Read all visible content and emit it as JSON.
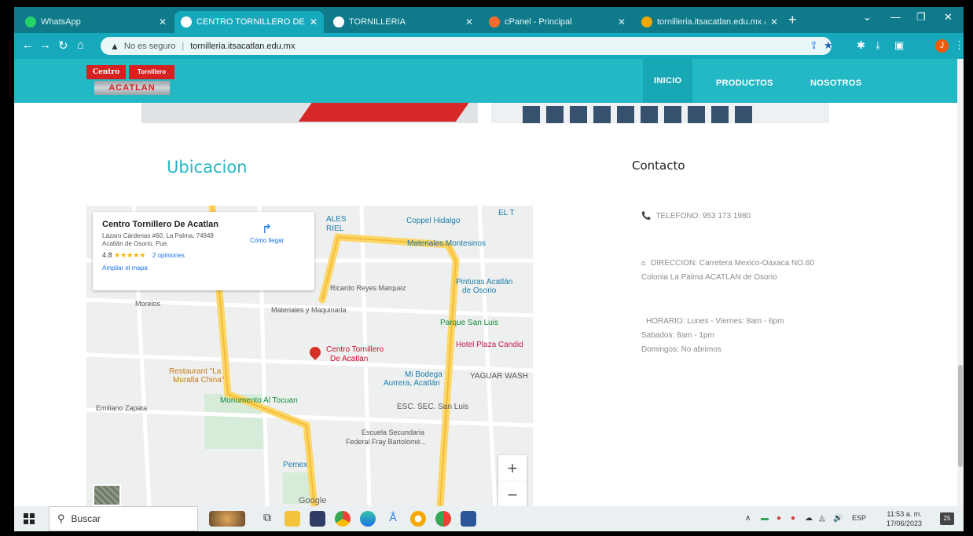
{
  "browser": {
    "tabs": [
      {
        "title": "WhatsApp",
        "color": "#25d366"
      },
      {
        "title": "CENTRO TORNILLERO DE AC",
        "color": "#ffffff"
      },
      {
        "title": "TORNILLERIA",
        "color": "#ffffff"
      },
      {
        "title": "cPanel - Principal",
        "color": "#ff6c2c"
      },
      {
        "title": "tornilleria.itsacatlan.edu.mx / loc",
        "color": "#f6a800"
      }
    ],
    "security_label": "No es seguro",
    "url": "tornilleria.itsacatlan.edu.mx",
    "profile_initial": "J"
  },
  "site": {
    "logo": {
      "left": "Centro",
      "right": "Tornillero",
      "bottom": "ACATLAN"
    },
    "nav": [
      "INICIO",
      "PRODUCTOS",
      "NOSOTROS"
    ],
    "accent_color": "#22b8c4"
  },
  "sections": {
    "location_title": "Ubicacion",
    "contact_title": "Contacto"
  },
  "contact": {
    "phone": "TELEFONO: 953 173 1980",
    "address_line1": "DIRECCION: Carretera Mexico-Oaxaca NO.60",
    "address_line2": "Colonia La Palma ACATLAN de Osorio",
    "hours_line1": "HORARIO: Lunes - Viernes: 8am - 6pm",
    "hours_line2": "Sabados: 8am - 1pm",
    "hours_line3": "Domingos: No abrimos"
  },
  "map": {
    "card": {
      "title": "Centro Tornillero De Acatlan",
      "address": "Lázaro Cárdenas #60, La Palma, 74949 Acatlán de Osorio, Pue.",
      "rating": "4.8",
      "stars": "★★★★★",
      "reviews": "2 opiniones",
      "enlarge": "Ampliar el mapa",
      "directions": "Cómo llegar"
    },
    "places": {
      "coppel": "Coppel Hidalgo",
      "materiales_montesinos": "Materiales Montesinos",
      "pinturas": "Pinturas Acatlán",
      "pinturas2": "de Osorio",
      "ricardo": "Ricardo Reyes Marquez",
      "materiales_maq": "Materiales y Maquinaria",
      "parque": "Parque San Luis",
      "centro": "Centro Tornillero",
      "centro2": "De Acatlan",
      "hotel": "Hotel Plaza Candid",
      "restaurant": "Restaurant \"La",
      "restaurant2": "Muralla China\"",
      "mi_bodega": "Mi Bodega",
      "mi_bodega2": "Aurrera, Acatlán",
      "yaguar": "YAGUAR WASH",
      "monumento": "Monumento Al Tocuan",
      "esc_sec": "ESC. SEC. San Luis",
      "escuela": "Escuela Secundaria",
      "escuela2": "Federal Fray Bartolomé...",
      "pemex": "Pemex",
      "zapata": "Emiliano Zapata",
      "morelos": "Morelos",
      "ales": "ALES",
      "riel": "RIEL",
      "el_t": "EL T",
      "google": "Google"
    },
    "zoom_in": "+",
    "zoom_out": "−"
  },
  "taskbar": {
    "search": "Buscar",
    "lang": "ESP",
    "time": "11:53 a. m.",
    "date": "17/06/2023",
    "notif_count": "25"
  }
}
